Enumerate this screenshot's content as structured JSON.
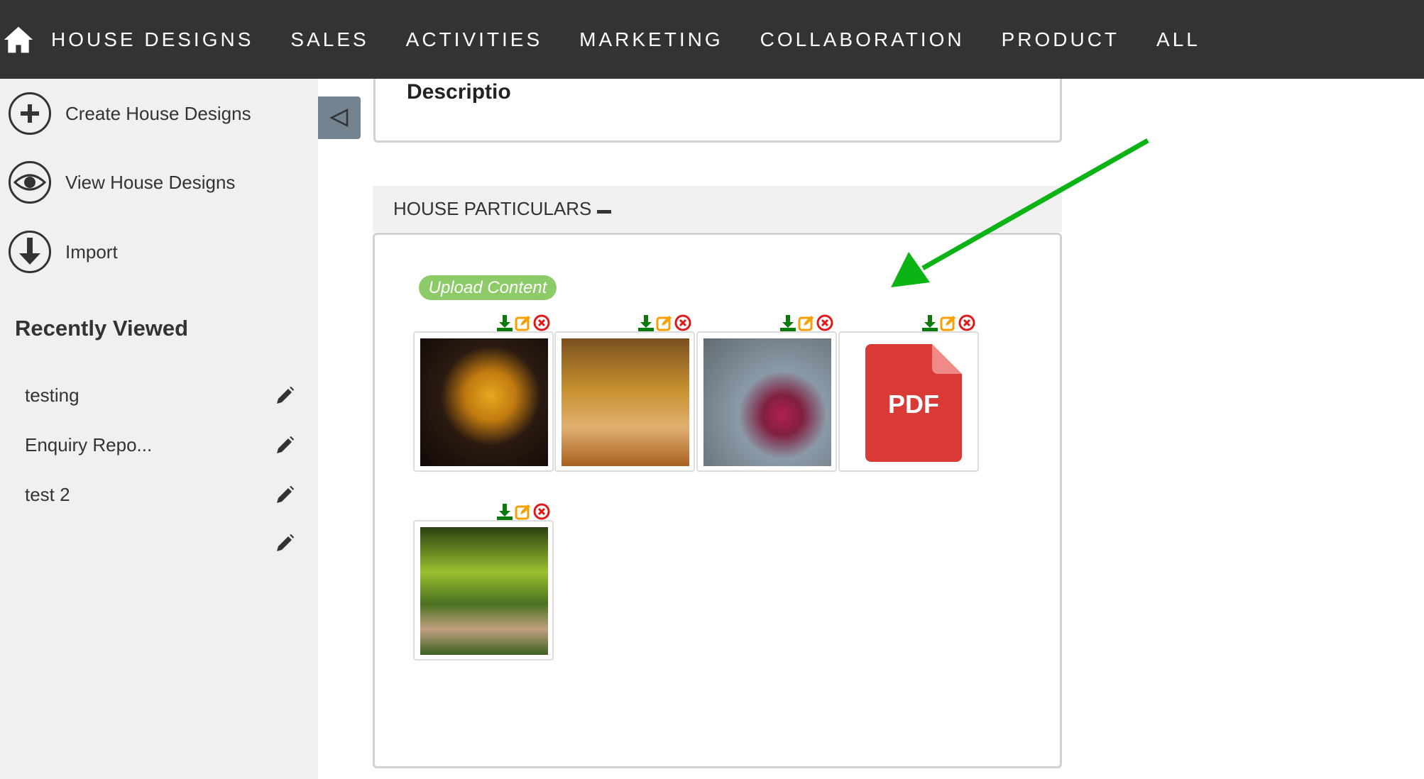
{
  "nav": {
    "items": [
      "HOUSE DESIGNS",
      "SALES",
      "ACTIVITIES",
      "MARKETING",
      "COLLABORATION",
      "PRODUCT",
      "ALL"
    ]
  },
  "sidebar": {
    "actions": [
      {
        "label": "Create House Designs",
        "icon": "plus-circle-icon"
      },
      {
        "label": "View House Designs",
        "icon": "eye-icon"
      },
      {
        "label": "Import",
        "icon": "download-circle-icon"
      }
    ],
    "recently_viewed_title": "Recently Viewed",
    "recent": [
      "testing",
      "Enquiry Repo...",
      "test 2",
      ""
    ]
  },
  "main": {
    "description_title": "Descriptio",
    "section_title": "HOUSE PARTICULARS",
    "upload_label": "Upload Content",
    "files": [
      {
        "type": "image",
        "subject": "parrot"
      },
      {
        "type": "image",
        "subject": "autumn path"
      },
      {
        "type": "image",
        "subject": "apple"
      },
      {
        "type": "pdf",
        "label": "PDF"
      },
      {
        "type": "image",
        "subject": "forest path"
      }
    ]
  },
  "colors": {
    "nav": "#333333",
    "upload": "#8dcb69",
    "arrow": "#0bb315",
    "pdf": "#d93a36",
    "download": "#0a7a0a",
    "edit": "#f5a000",
    "delete": "#e01818"
  }
}
